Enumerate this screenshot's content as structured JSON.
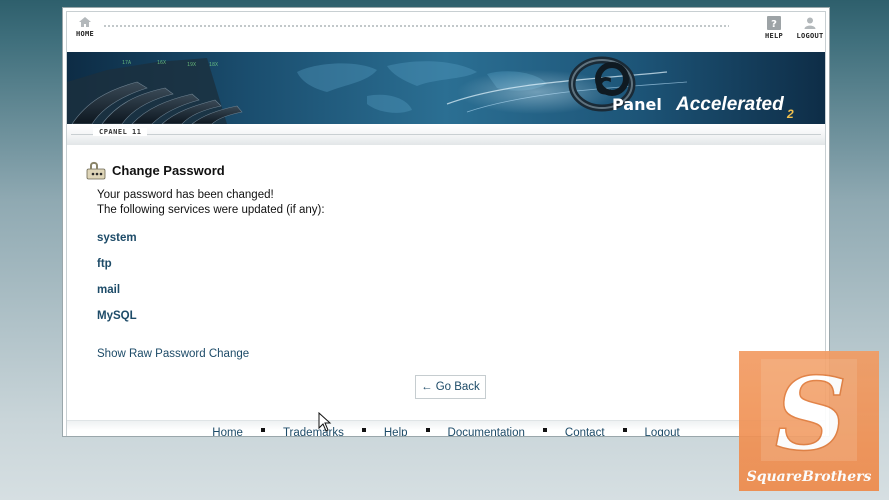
{
  "nav": {
    "home_label": "HOME",
    "help_label": "HELP",
    "logout_label": "LOGOUT"
  },
  "banner": {
    "brand_c": "c",
    "brand_panel": "Panel",
    "brand_accelerated": "Accelerated",
    "brand_suffix": "2"
  },
  "version_label": "CPANEL 11",
  "page": {
    "title": "Change Password",
    "message_line1": "Your password has been changed!",
    "message_line2": "The following services were updated (if any):",
    "services": [
      "system",
      "ftp",
      "mail",
      "MySQL"
    ],
    "raw_link": "Show Raw Password Change",
    "go_back": "← Go Back"
  },
  "footer": {
    "links": [
      "Home",
      "Trademarks",
      "Help",
      "Documentation",
      "Contact",
      "Logout"
    ]
  },
  "watermark": {
    "letter": "S",
    "brand": "SquareBrothers"
  },
  "colors": {
    "link": "#1d4b68",
    "accent_orange": "#ef8a4a"
  }
}
